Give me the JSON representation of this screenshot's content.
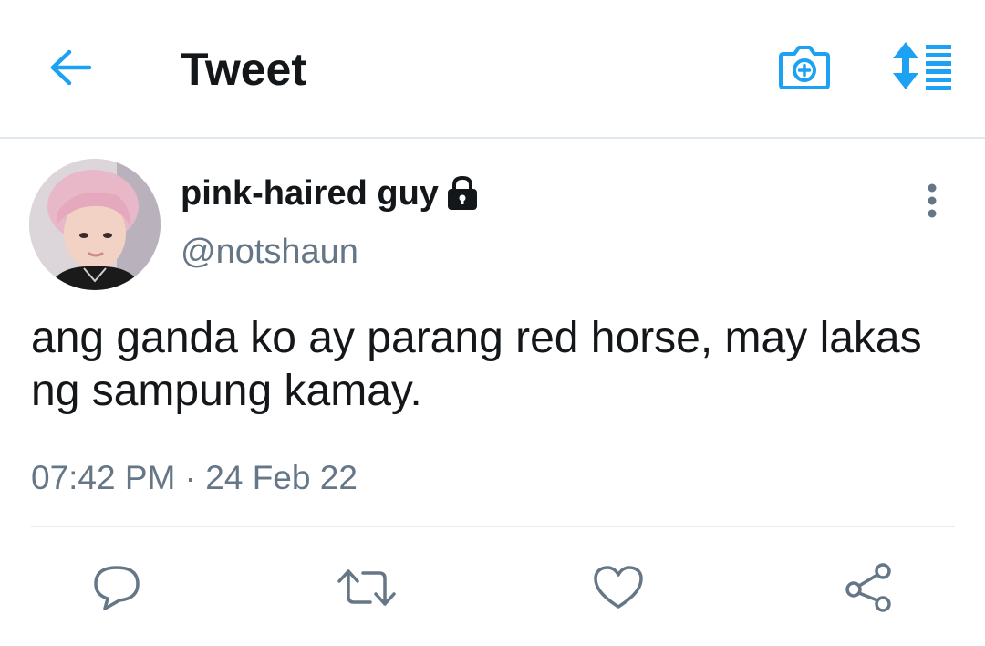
{
  "header": {
    "title": "Tweet",
    "back_icon": "back-arrow-icon",
    "camera_icon": "camera-add-icon",
    "sort_icon": "sort-icon",
    "accent_color": "#1da1f2"
  },
  "tweet": {
    "display_name": "pink-haired guy",
    "handle": "@notshaun",
    "protected": true,
    "text": "ang ganda ko ay parang red horse, may lakas ng sampung kamay.",
    "time": "07:42 PM",
    "separator": "·",
    "date": "24 Feb 22"
  },
  "actions": [
    {
      "name": "reply",
      "icon": "reply-icon"
    },
    {
      "name": "retweet",
      "icon": "retweet-icon"
    },
    {
      "name": "like",
      "icon": "heart-icon"
    },
    {
      "name": "share",
      "icon": "share-icon"
    }
  ],
  "colors": {
    "text_primary": "#14171a",
    "text_secondary": "#657786",
    "action_icon": "#657786",
    "divider": "#e1e8ed"
  }
}
